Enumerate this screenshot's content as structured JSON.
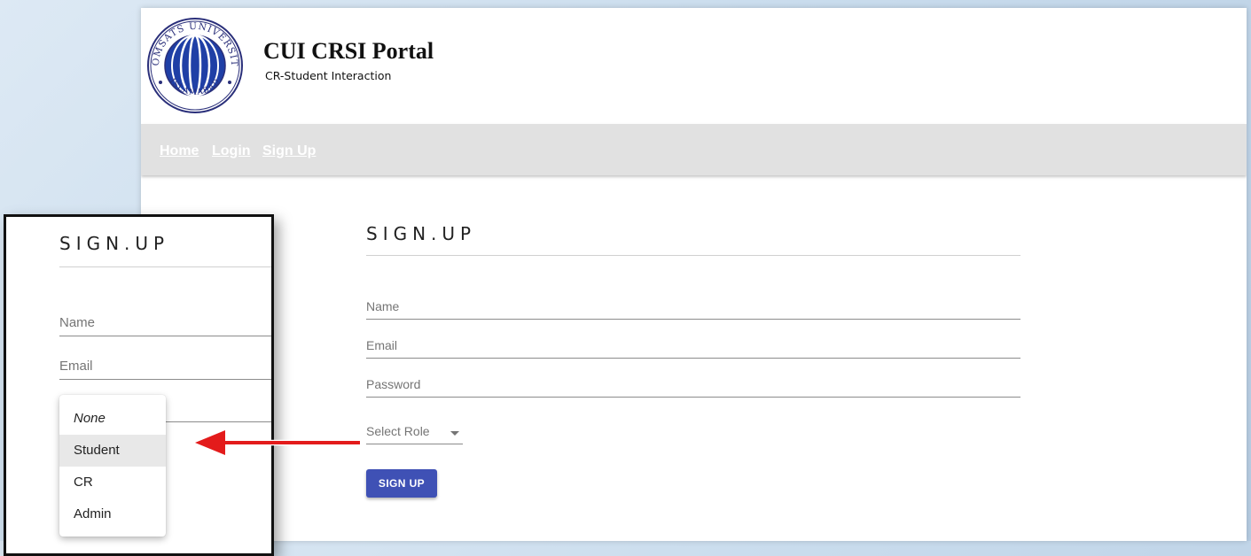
{
  "header": {
    "logo": {
      "top_text": "COMSATS UNIVERSITY",
      "bottom_text": "ISLAMABAD",
      "icon": "university-globe-logo"
    },
    "title": "CUI CRSI Portal",
    "subtitle": "CR-Student Interaction"
  },
  "nav": {
    "home": "Home",
    "login": "Login",
    "signup": "Sign Up"
  },
  "form": {
    "title": "SIGN.UP",
    "name_label": "Name",
    "email_label": "Email",
    "password_label": "Password",
    "role_label": "Select Role",
    "submit_label": "SIGN UP"
  },
  "inset": {
    "title": "SIGN.UP",
    "name_label": "Name",
    "email_label": "Email",
    "role_options": [
      {
        "label": "None",
        "selected": false
      },
      {
        "label": "Student",
        "selected": true
      },
      {
        "label": "CR",
        "selected": false
      },
      {
        "label": "Admin",
        "selected": false
      }
    ]
  },
  "colors": {
    "primary_button": "#3f51b5",
    "navbar": "#e1e1e1",
    "arrow": "#e31b1b"
  }
}
